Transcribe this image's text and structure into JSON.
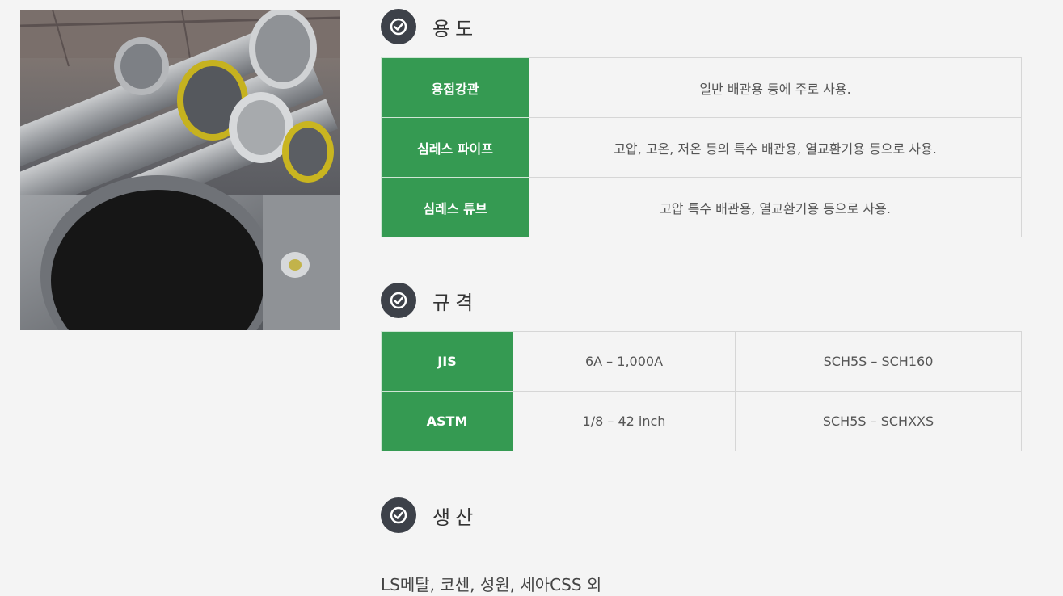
{
  "photo": {
    "alt": "stainless steel pipes"
  },
  "usage": {
    "title": "용도",
    "rows": [
      {
        "label": "용접강관",
        "desc": "일반 배관용 등에 주로 사용."
      },
      {
        "label": "심레스 파이프",
        "desc": "고압, 고온, 저온 등의 특수 배관용, 열교환기용 등으로 사용."
      },
      {
        "label": "심레스 튜브",
        "desc": "고압 특수 배관용, 열교환기용 등으로 사용."
      }
    ]
  },
  "spec": {
    "title": "규격",
    "rows": [
      {
        "label": "JIS",
        "size": "6A – 1,000A",
        "schedule": "SCH5S – SCH160"
      },
      {
        "label": "ASTM",
        "size": "1/8 – 42 inch",
        "schedule": "SCH5S – SCHXXS"
      }
    ]
  },
  "production": {
    "title": "생산",
    "producers": "LS메탈, 코센, 성원, 세아CSS 외"
  },
  "colors": {
    "accent_green": "#359a52",
    "icon_dark": "#3d4149"
  }
}
